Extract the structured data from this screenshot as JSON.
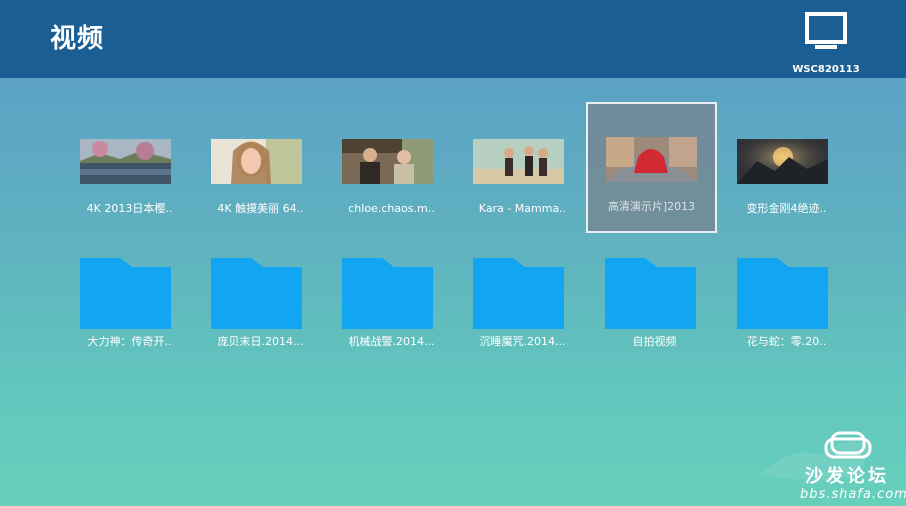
{
  "header": {
    "title": "视频",
    "device_icon": "monitor-icon",
    "device_name": "WSC820113"
  },
  "videos": [
    {
      "label": "4K 2013日本樱.."
    },
    {
      "label": "4K 触摸美丽 64.."
    },
    {
      "label": "chloe.chaos.m.."
    },
    {
      "label": "Kara - Mamma.."
    },
    {
      "label": "高清演示片]2013"
    },
    {
      "label": "变形金刚4绝迹.."
    }
  ],
  "folders": [
    {
      "label": "大力神：传奇开.."
    },
    {
      "label": "庞贝末日.2014..."
    },
    {
      "label": "机械战警.2014..."
    },
    {
      "label": "沉睡魔咒.2014..."
    },
    {
      "label": "自拍视频"
    },
    {
      "label": "花与蛇：零.20.."
    }
  ],
  "selected_index": 4,
  "colors": {
    "header_bg": "#1a5e93",
    "folder": "#12a5f2",
    "folder_dark": "#0e8fd6"
  },
  "watermark": {
    "text": "沙发论坛",
    "url": "bbs.shafa.com"
  }
}
